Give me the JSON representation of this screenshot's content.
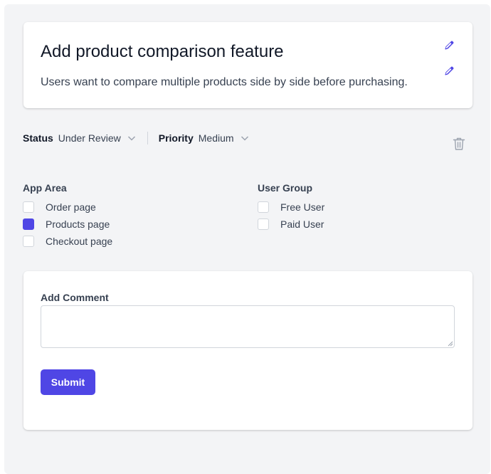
{
  "feature": {
    "title": "Add product comparison feature",
    "description": "Users want to compare multiple products side by side before purchasing.",
    "edit_icon": "pencil-icon"
  },
  "meta": {
    "status_label": "Status",
    "status_value": "Under Review",
    "priority_label": "Priority",
    "priority_value": "Medium",
    "delete_icon": "trash-icon"
  },
  "app_area": {
    "title": "App Area",
    "options": [
      {
        "label": "Order page",
        "checked": false
      },
      {
        "label": "Products page",
        "checked": true
      },
      {
        "label": "Checkout page",
        "checked": false
      }
    ]
  },
  "user_group": {
    "title": "User Group",
    "options": [
      {
        "label": "Free User",
        "checked": false
      },
      {
        "label": "Paid User",
        "checked": false
      }
    ]
  },
  "comment": {
    "label": "Add Comment",
    "value": "",
    "submit_label": "Submit"
  },
  "colors": {
    "accent": "#4f46e5",
    "background": "#f3f4f6",
    "card": "#ffffff",
    "muted_icon": "#9ca3af"
  }
}
